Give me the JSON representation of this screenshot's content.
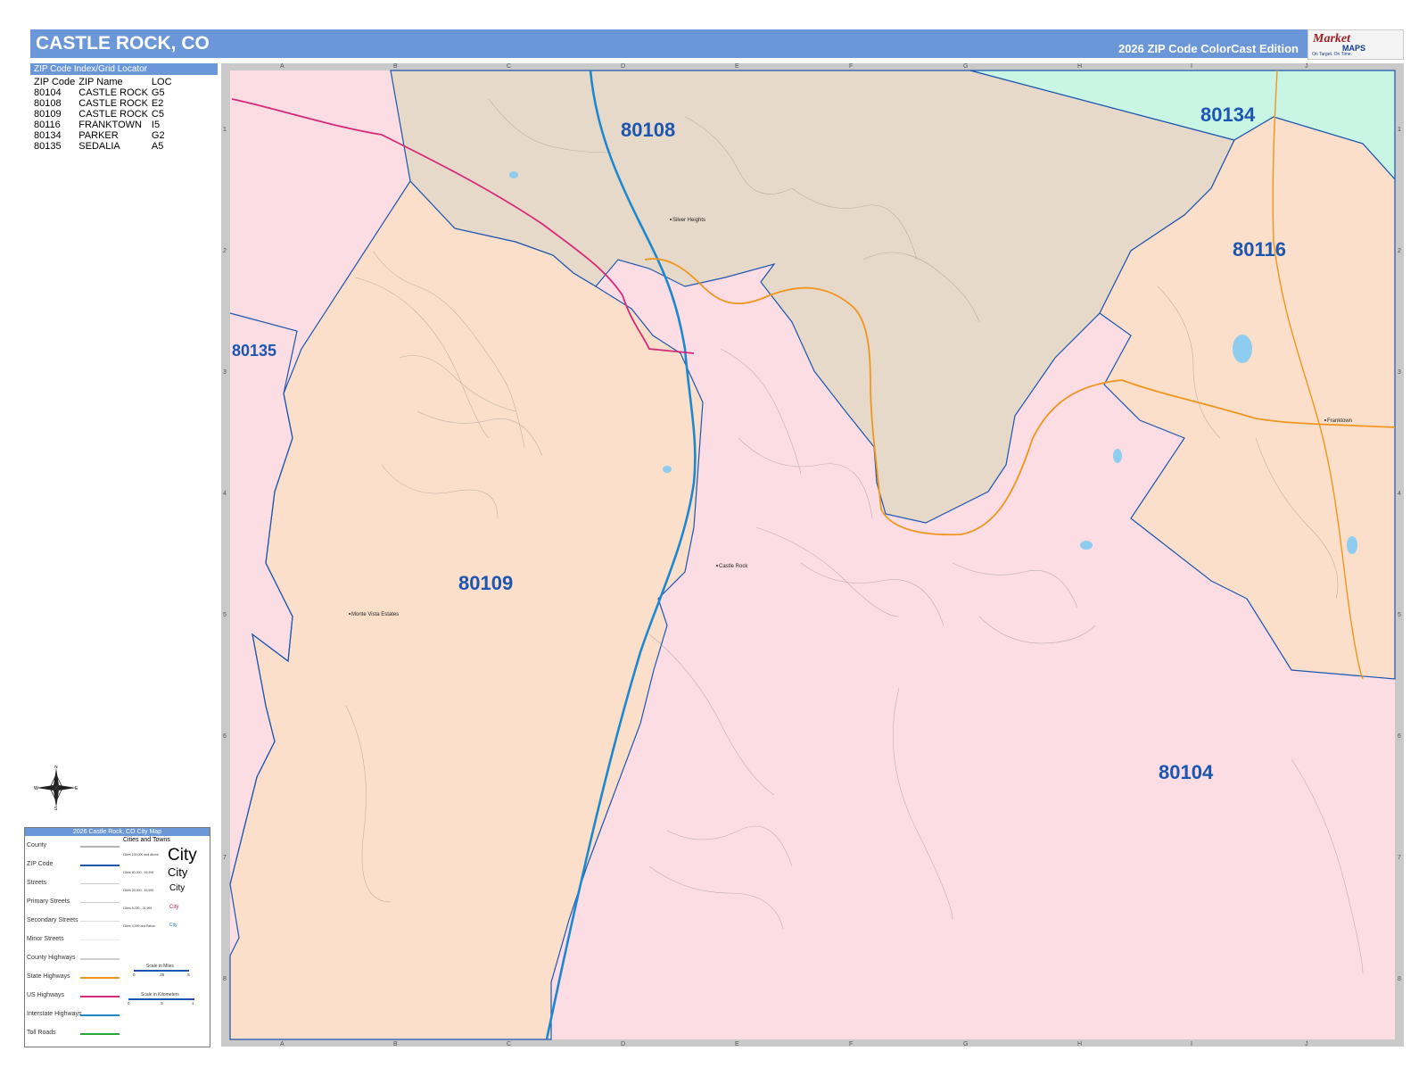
{
  "header": {
    "title": "CASTLE ROCK, CO",
    "edition": "2026 ZIP Code ColorCast Edition"
  },
  "logo": {
    "brand_a": "Market",
    "brand_b": "MAPS",
    "tagline": "On Target. On Time."
  },
  "zip_index": {
    "title": "ZIP Code Index/Grid Locator",
    "columns": [
      "ZIP Code",
      "ZIP Name",
      "LOC"
    ],
    "rows": [
      [
        "80104",
        "CASTLE ROCK",
        "G5"
      ],
      [
        "80108",
        "CASTLE ROCK",
        "E2"
      ],
      [
        "80109",
        "CASTLE ROCK",
        "C5"
      ],
      [
        "80116",
        "FRANKTOWN",
        "I5"
      ],
      [
        "80134",
        "PARKER",
        "G2"
      ],
      [
        "80135",
        "SEDALIA",
        "A5"
      ]
    ]
  },
  "map": {
    "zip_labels": {
      "z80108": "80108",
      "z80134": "80134",
      "z80116": "80116",
      "z80135": "80135",
      "z80109": "80109",
      "z80104": "80104"
    },
    "places": {
      "silver": "Silver Heights",
      "castle": "Castle Rock",
      "monte": "Monte Vista Estates",
      "frank": "Franktown"
    },
    "grid_cols": [
      "A",
      "B",
      "C",
      "D",
      "E",
      "F",
      "G",
      "H",
      "I",
      "J"
    ],
    "grid_rows": [
      "1",
      "2",
      "3",
      "4",
      "5",
      "6",
      "7",
      "8"
    ],
    "colors": {
      "z80104": "#fcdde3",
      "z80108": "#e7d9c9",
      "z80109": "#fbdfca",
      "z80116": "#fbdfca",
      "z80134": "#c9f5e4",
      "z80135": "#fcdde3",
      "zip_border": "#1c56b0",
      "interstate": "#1e88cf",
      "us_highway": "#d6297a",
      "state_highway": "#f0961f"
    }
  },
  "legend": {
    "title": "2026 Castle Rock, CO City Map",
    "items": [
      "County",
      "ZIP Code",
      "Streets",
      "Primary Streets",
      "Secondary Streets",
      "Minor Streets",
      "County Highways",
      "State Highways",
      "US Highways",
      "Interstate Highways",
      "Toll Roads"
    ],
    "cities_title": "Cities and Towns",
    "city_sizes": [
      "Cities 100,000 and Above",
      "Cities 50,000 - 99,999",
      "Cities 25,000 - 49,999",
      "Cities 5,000 - 24,999",
      "Cities 4,999 and Below"
    ],
    "city_word": "City",
    "scale_miles": "Scale in Miles",
    "scale_km": "Scale in Kilometers",
    "scale_vals_miles": [
      "0",
      ".25",
      ".5"
    ],
    "scale_vals_km": [
      "0",
      ".5",
      "1"
    ]
  },
  "compass": {
    "n": "N",
    "s": "S",
    "e": "E",
    "w": "W"
  }
}
